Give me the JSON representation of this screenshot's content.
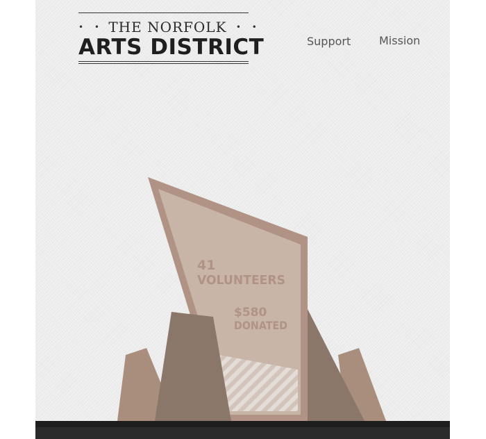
{
  "logo": {
    "top_line": "THE NORFOLK",
    "main_line": "ARTS DISTRICT",
    "dots_left": "• •",
    "dots_right": "• •"
  },
  "nav": {
    "items": [
      {
        "label": "Support"
      },
      {
        "label": "Mission"
      }
    ]
  },
  "stats": {
    "volunteers_count": "41",
    "volunteers_label": "VOLUNTEERS",
    "donated_amount": "$580",
    "donated_label": "DONATED"
  },
  "colors": {
    "page_bg": "#ececec",
    "monument_frame": "#b09384",
    "monument_panel": "#c8b5a8",
    "stat_text": "#b09384",
    "rock_dark": "#8a7769",
    "rock_light": "#a98e7e",
    "footer": "#2b2b2b"
  }
}
